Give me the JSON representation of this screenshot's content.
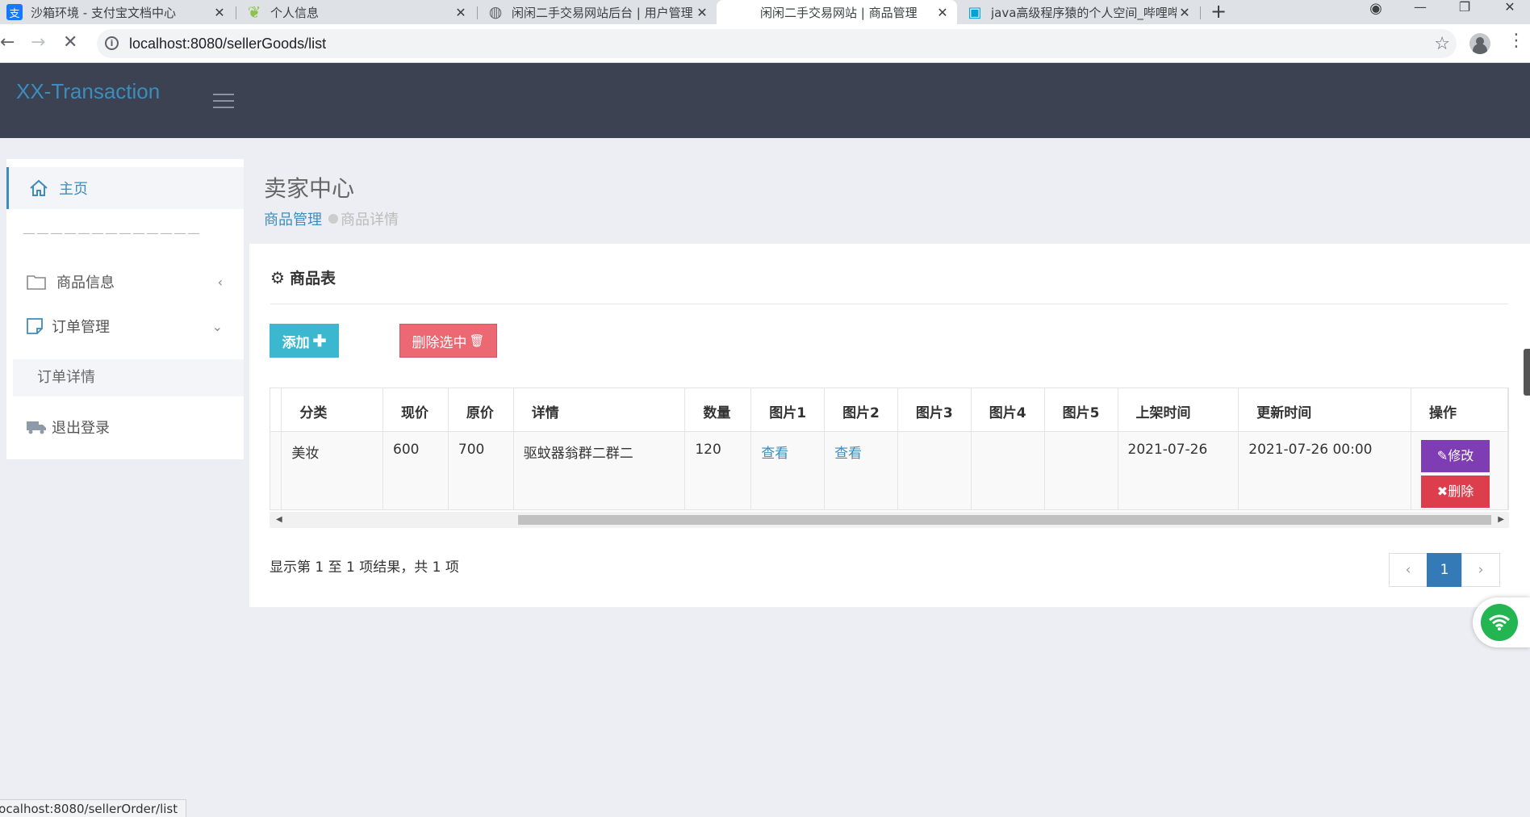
{
  "browser": {
    "tabs": [
      {
        "title": "沙箱环境 - 支付宝文档中心",
        "favicon": "alipay-icon",
        "color": "#1677ff",
        "active": false
      },
      {
        "title": "个人信息",
        "favicon": "leaf-icon",
        "color": "#8bc34a",
        "active": false
      },
      {
        "title": "闲闲二手交易网站后台 | 用户管理",
        "favicon": "globe-icon",
        "color": "#5f6368",
        "active": false
      },
      {
        "title": "闲闲二手交易网站 | 商品管理",
        "favicon": "loading-icon",
        "color": "#ffffff",
        "active": true
      },
      {
        "title": "java高级程序猿的个人空间_哔哩哔哩",
        "favicon": "bilibili-icon",
        "color": "#00a1d6",
        "active": false
      }
    ],
    "url": "localhost:8080/sellerGoods/list",
    "status_url": "localhost:8080/sellerOrder/list"
  },
  "app": {
    "brand": "XX-Transaction",
    "accent": "#3c8dbc",
    "topbar_color": "#3c4252"
  },
  "sidebar": {
    "home": "主页",
    "divider": "—————————————",
    "goods_info": "商品信息",
    "order_mgmt": "订单管理",
    "order_detail": "订单详情",
    "logout": "退出登录"
  },
  "content": {
    "title": "卖家中心",
    "breadcrumb_link": "商品管理",
    "breadcrumb_current": "商品详情"
  },
  "panel": {
    "title": "商品表",
    "add_label": "添加",
    "delete_selected_label": "删除选中",
    "columns": [
      "分类",
      "现价",
      "原价",
      "详情",
      "数量",
      "图片1",
      "图片2",
      "图片3",
      "图片4",
      "图片5",
      "上架时间",
      "更新时间",
      "操作"
    ],
    "rows": [
      {
        "category": "美妆",
        "price": "600",
        "original_price": "700",
        "detail": "驱蚊器翁群二群二",
        "quantity": "120",
        "pic1": "查看",
        "pic2": "查看",
        "pic3": "",
        "pic4": "",
        "pic5": "",
        "listed_time": "2021-07-26",
        "updated_time": "2021-07-26 00:00",
        "edit_label": "修改",
        "delete_label": "删除"
      }
    ],
    "info": "显示第 1 至 1 项结果，共 1 项",
    "pager": {
      "prev": "‹",
      "current": "1",
      "next": "›"
    }
  }
}
